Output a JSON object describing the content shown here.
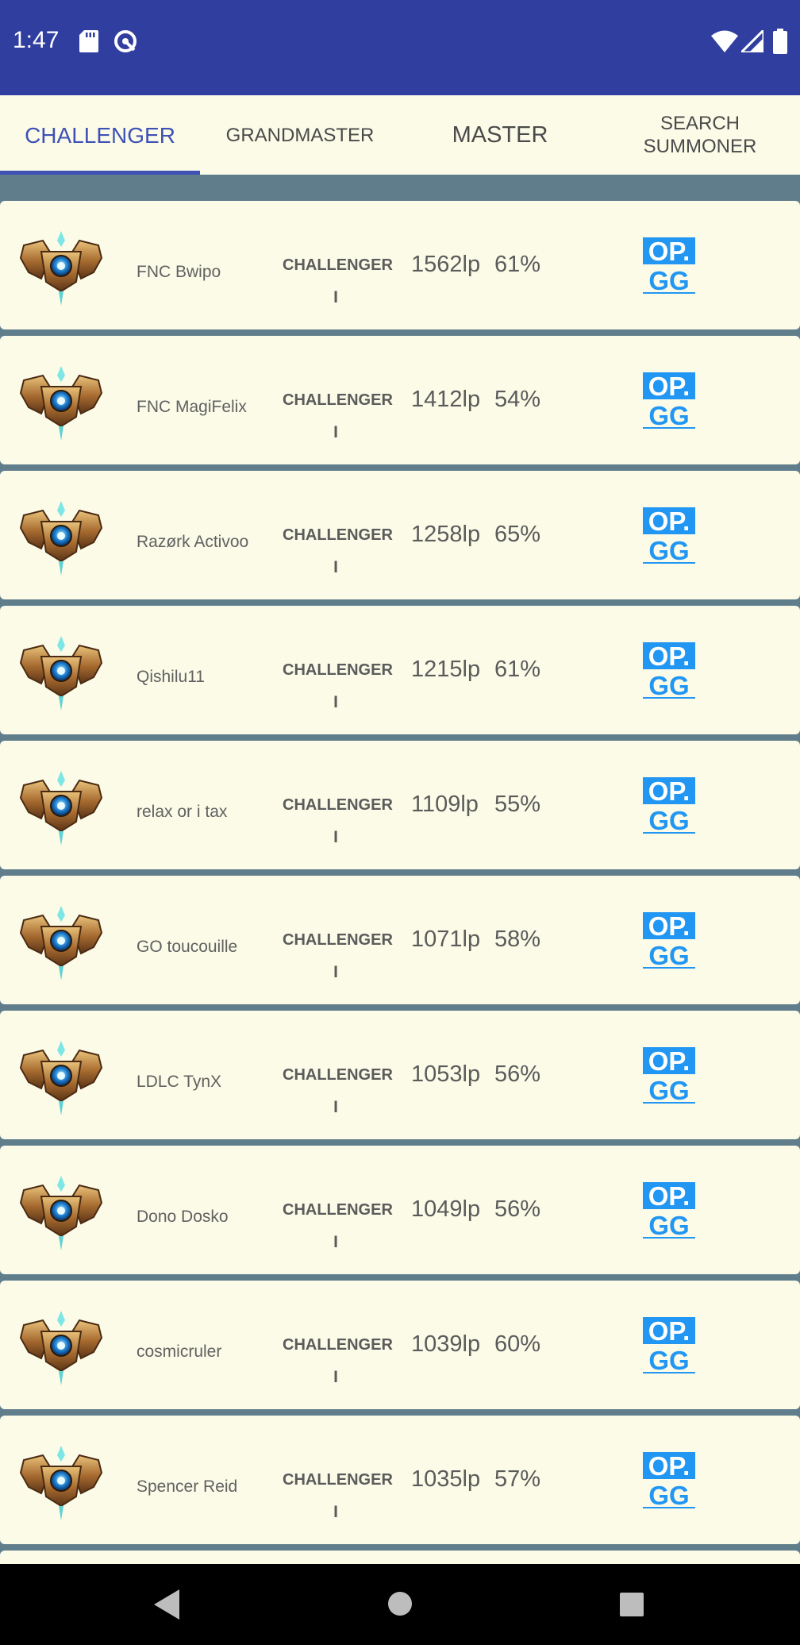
{
  "status_bar": {
    "time": "1:47",
    "icons": [
      "sd-card-icon",
      "vpn-icon",
      "wifi-icon",
      "signal-icon",
      "battery-icon"
    ]
  },
  "tabs": [
    {
      "label": "CHALLENGER",
      "active": true
    },
    {
      "label": "GRANDMASTER",
      "active": false
    },
    {
      "label": "MASTER",
      "active": false
    },
    {
      "label": "SEARCH SUMMONER",
      "active": false
    }
  ],
  "rows": [
    {
      "name": "FNC Bwipo",
      "tier": "CHALLENGER",
      "division": "I",
      "lp": "1562lp",
      "winrate": "61%"
    },
    {
      "name": "FNC MagiFelix",
      "tier": "CHALLENGER",
      "division": "I",
      "lp": "1412lp",
      "winrate": "54%"
    },
    {
      "name": "Razørk Activoo",
      "tier": "CHALLENGER",
      "division": "I",
      "lp": "1258lp",
      "winrate": "65%"
    },
    {
      "name": "Qishilu11",
      "tier": "CHALLENGER",
      "division": "I",
      "lp": "1215lp",
      "winrate": "61%"
    },
    {
      "name": "relax or i tax",
      "tier": "CHALLENGER",
      "division": "I",
      "lp": "1109lp",
      "winrate": "55%"
    },
    {
      "name": "GO toucouille",
      "tier": "CHALLENGER",
      "division": "I",
      "lp": "1071lp",
      "winrate": "58%"
    },
    {
      "name": "LDLC TynX",
      "tier": "CHALLENGER",
      "division": "I",
      "lp": "1053lp",
      "winrate": "56%"
    },
    {
      "name": "Dono Dosko",
      "tier": "CHALLENGER",
      "division": "I",
      "lp": "1049lp",
      "winrate": "56%"
    },
    {
      "name": "cosmicruler",
      "tier": "CHALLENGER",
      "division": "I",
      "lp": "1039lp",
      "winrate": "60%"
    },
    {
      "name": "Spencer Reid",
      "tier": "CHALLENGER",
      "division": "I",
      "lp": "1035lp",
      "winrate": "57%"
    }
  ],
  "opgg_logo": {
    "top": "OP.",
    "bottom": "GG"
  },
  "colors": {
    "primary": "#3f51b5",
    "status_bar": "#303f9f",
    "card_background": "#fbfbe8",
    "list_background": "#607d8b",
    "opgg_blue": "#2196f3"
  },
  "nav_bar": {
    "icons": [
      "back-icon",
      "home-icon",
      "recents-icon"
    ]
  }
}
